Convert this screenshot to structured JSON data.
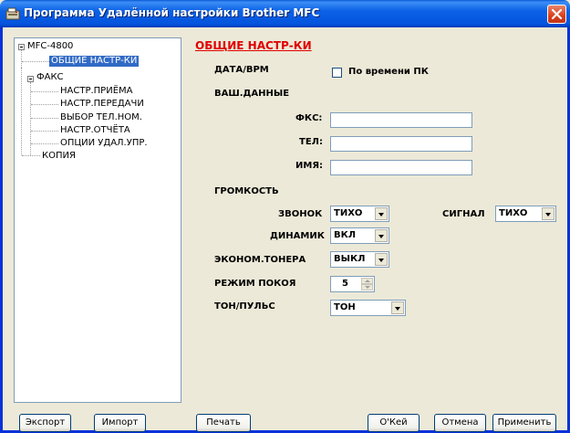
{
  "window": {
    "title": "Программа Удалённой настройки Brother MFC"
  },
  "tree": {
    "root": "MFC-4800",
    "general": "ОБЩИЕ НАСТР-КИ",
    "fax": "ФАКС",
    "fax_children": [
      "НАСТР.ПРИЁМА",
      "НАСТР.ПЕРЕДАЧИ",
      "ВЫБОР ТЕЛ.НОМ.",
      "НАСТР.ОТЧЁТА",
      "ОПЦИИ УДАЛ.УПР."
    ],
    "copy": "КОПИЯ"
  },
  "panel": {
    "title": "ОБЩИЕ НАСТР-КИ",
    "date_label": "ДАТА/ВРМ",
    "pc_time_label": "По времени ПК",
    "pc_time_checked": false,
    "station_label": "ВАШ.ДАННЫЕ",
    "fax_label": "ФКС:",
    "fax_value": "",
    "tel_label": "ТЕЛ:",
    "tel_value": "",
    "name_label": "ИМЯ:",
    "name_value": "",
    "volume_label": "ГРОМКОСТЬ",
    "ring_label": "ЗВОНОК",
    "ring_value": "ТИХО",
    "beeper_label": "СИГНАЛ",
    "beeper_value": "ТИХО",
    "speaker_label": "ДИНАМИК",
    "speaker_value": "ВКЛ",
    "toner_label": "ЭКОНОМ.ТОНЕРА",
    "toner_value": "ВЫКЛ",
    "sleep_label": "РЕЖИМ ПОКОЯ",
    "sleep_value": "5",
    "dial_label": "ТОН/ПУЛЬС",
    "dial_value": "ТОН"
  },
  "buttons": {
    "export": "Экспорт",
    "import": "Импорт",
    "print": "Печать",
    "ok": "О'Кей",
    "cancel": "Отмена",
    "apply": "Применить"
  }
}
